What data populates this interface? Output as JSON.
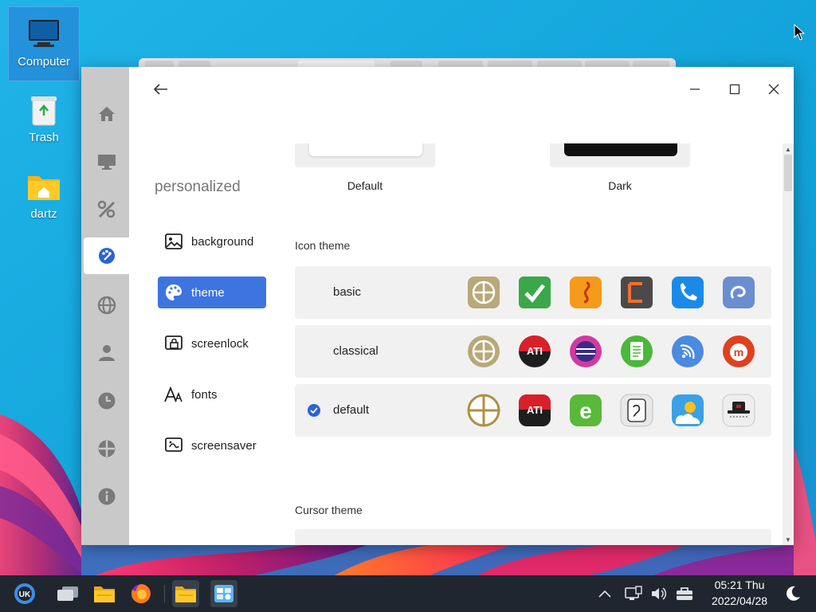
{
  "desktop": {
    "icons": [
      {
        "label": "Computer"
      },
      {
        "label": "Trash"
      },
      {
        "label": "dartz"
      }
    ]
  },
  "window": {
    "section_title": "personalized",
    "nav": [
      {
        "label": "background",
        "icon": "image-icon"
      },
      {
        "label": "theme",
        "icon": "palette-icon",
        "active": true
      },
      {
        "label": "screenlock",
        "icon": "screenlock-icon"
      },
      {
        "label": "fonts",
        "icon": "fonts-icon"
      },
      {
        "label": "screensaver",
        "icon": "screensaver-icon"
      }
    ],
    "rail": [
      "home-icon",
      "monitor-icon",
      "tools-icon",
      "palette-icon",
      "globe-icon",
      "user-icon",
      "clock-icon",
      "update-icon",
      "info-icon"
    ],
    "window_theme_previews": [
      {
        "label": "Default"
      },
      {
        "label": "Dark"
      }
    ],
    "icon_theme": {
      "heading": "Icon theme",
      "themes": [
        {
          "name": "basic",
          "selected": false
        },
        {
          "name": "classical",
          "selected": false
        },
        {
          "name": "default",
          "selected": true
        }
      ]
    },
    "cursor_theme": {
      "heading": "Cursor theme"
    }
  },
  "taskbar": {
    "time": "05:21 Thu",
    "date": "2022/04/28"
  },
  "colors": {
    "accent": "#3e74e0",
    "taskbar": "#1f2630",
    "rail": "#c9c9c9"
  }
}
